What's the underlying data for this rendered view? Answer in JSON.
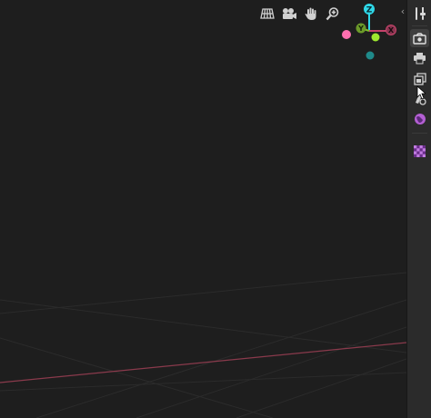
{
  "viewport": {
    "background": "#1e1e1e",
    "grid_color": "#2a2a2a",
    "x_axis_color": "#8a3a4c"
  },
  "nav_tools": [
    {
      "name": "perspective-grid-icon",
      "tooltip": ""
    },
    {
      "name": "camera-icon",
      "tooltip": ""
    },
    {
      "name": "hand-pan-icon",
      "tooltip": ""
    },
    {
      "name": "zoom-icon",
      "tooltip": ""
    }
  ],
  "gizmo": {
    "z_label": "Z",
    "y_label": "Y",
    "x_label": "X",
    "colors": {
      "z": "#2fd8e8",
      "y": "#7fbf2a",
      "x": "#c4436a",
      "neg_x": "#ff6fb0",
      "neg_y": "#1f8a8a"
    }
  },
  "properties_tabs": [
    {
      "name": "tool-icon",
      "active": false
    },
    {
      "name": "render-icon",
      "active": true
    },
    {
      "name": "output-printer-icon",
      "active": false
    },
    {
      "name": "view-layer-icon",
      "active": false
    },
    {
      "name": "scene-icon",
      "active": false
    },
    {
      "name": "world-icon",
      "active": false
    },
    {
      "name": "texture-checker-icon",
      "active": false
    }
  ]
}
